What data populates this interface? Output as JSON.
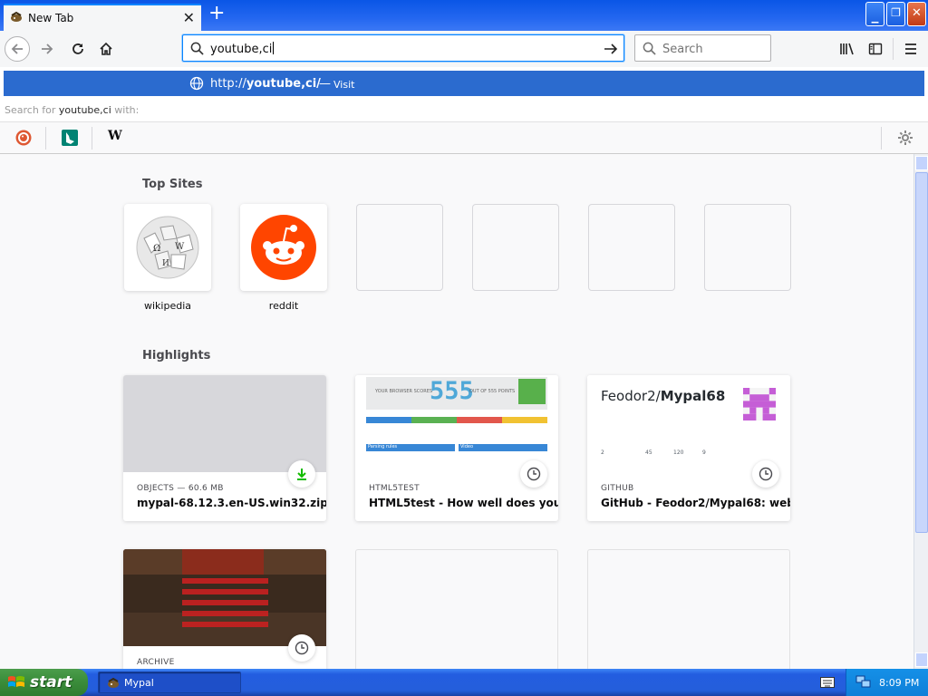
{
  "browser": {
    "tab_title": "New Tab",
    "new_tab": "+",
    "url_input": "youtube,ci",
    "search_placeholder": "Search"
  },
  "autocomplete": {
    "url_prefix": "http://",
    "url_bold": "youtube,ci/",
    "separator": "—",
    "action": "Visit",
    "search_for_prefix": "Search for",
    "search_for_query": "youtube,ci",
    "search_for_suffix": "with:",
    "engines": [
      "duckduckgo-icon",
      "bing-icon",
      "wikipedia-icon"
    ],
    "wiki_glyph": "W"
  },
  "top_sites": {
    "title": "Top Sites",
    "tiles": [
      {
        "label": "wikipedia"
      },
      {
        "label": "reddit"
      },
      {
        "label": ""
      },
      {
        "label": ""
      },
      {
        "label": ""
      },
      {
        "label": ""
      }
    ]
  },
  "highlights": {
    "title": "Highlights",
    "cards": [
      {
        "context": "OBJECTS — 60.6 MB",
        "title": "mypal-68.12.3.en-US.win32.zip",
        "badge": "download-icon"
      },
      {
        "context": "HTML5TEST",
        "title": "HTML5test - How well does you…",
        "badge": "clock-icon"
      },
      {
        "context": "GITHUB",
        "title": "GitHub - Feodor2/Mypal68: web…",
        "badge": "clock-icon"
      },
      {
        "context": "ARCHIVE",
        "title": "",
        "badge": "clock-icon"
      }
    ],
    "html5test": {
      "score_prefix": "YOUR BROWSER SCORES",
      "score": "555",
      "score_suffix": "OUT OF 555 POINTS",
      "col1": "Parsing rules",
      "col2": "Video"
    },
    "github": {
      "owner": "Feodor2/",
      "repo": "Mypal68",
      "stats": [
        "2",
        "45",
        "120",
        "9"
      ]
    }
  },
  "taskbar": {
    "start_label": "start",
    "task_label": "Mypal",
    "clock": "8:09 PM"
  }
}
